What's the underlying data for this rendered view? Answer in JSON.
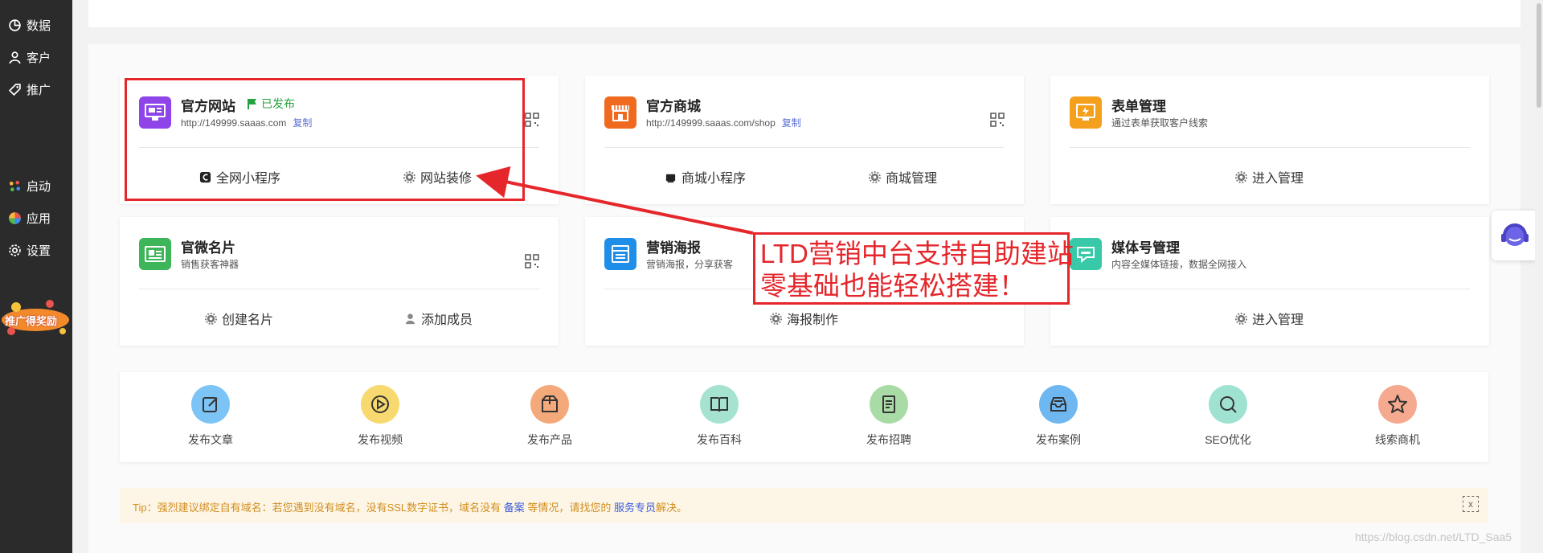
{
  "sidebar": {
    "items": [
      {
        "label": "数据",
        "icon": "chart-pie-icon"
      },
      {
        "label": "客户",
        "icon": "user-icon"
      },
      {
        "label": "推广",
        "icon": "tag-icon"
      },
      {
        "label": "启动",
        "icon": "dots-icon"
      },
      {
        "label": "应用",
        "icon": "apps-icon"
      },
      {
        "label": "设置",
        "icon": "gear-icon"
      }
    ],
    "promo": "推广得奖励"
  },
  "cards": [
    {
      "title": "官方网站",
      "status": "已发布",
      "url": "http://149999.saaas.com",
      "copy": "复制",
      "actions": [
        "全网小程序",
        "网站装修"
      ]
    },
    {
      "title": "官方商城",
      "url": "http://149999.saaas.com/shop",
      "copy": "复制",
      "actions": [
        "商城小程序",
        "商城管理"
      ]
    },
    {
      "title": "表单管理",
      "desc": "通过表单获取客户线索",
      "actions": [
        "进入管理"
      ]
    },
    {
      "title": "官微名片",
      "desc": "销售获客神器",
      "actions": [
        "创建名片",
        "添加成员"
      ]
    },
    {
      "title": "营销海报",
      "desc": "营销海报，分享获客",
      "actions": [
        "海报制作"
      ]
    },
    {
      "title": "媒体号管理",
      "desc": "内容全媒体链接，数据全网接入",
      "actions": [
        "进入管理"
      ]
    }
  ],
  "quick": [
    {
      "label": "发布文章",
      "color": "#7cc4f5"
    },
    {
      "label": "发布视频",
      "color": "#f7d96f"
    },
    {
      "label": "发布产品",
      "color": "#f3a97a"
    },
    {
      "label": "发布百科",
      "color": "#a5e3d0"
    },
    {
      "label": "发布招聘",
      "color": "#a8dba5"
    },
    {
      "label": "发布案例",
      "color": "#6fb7f0"
    },
    {
      "label": "SEO优化",
      "color": "#9fe2d2"
    },
    {
      "label": "线索商机",
      "color": "#f5a98e"
    }
  ],
  "tip": {
    "prefix": "Tip：强烈建议绑定自有域名：若您遇到没有域名，没有SSL数字证书，域名没有 ",
    "link1": "备案",
    "middle": " 等情况，请找您的 ",
    "link2": "服务专员",
    "suffix": "解决。",
    "close": "x"
  },
  "callout": {
    "line1": "LTD营销中台支持自助建站",
    "line2": "零基础也能轻松搭建！"
  },
  "watermark": "https://blog.csdn.net/LTD_Saa5"
}
